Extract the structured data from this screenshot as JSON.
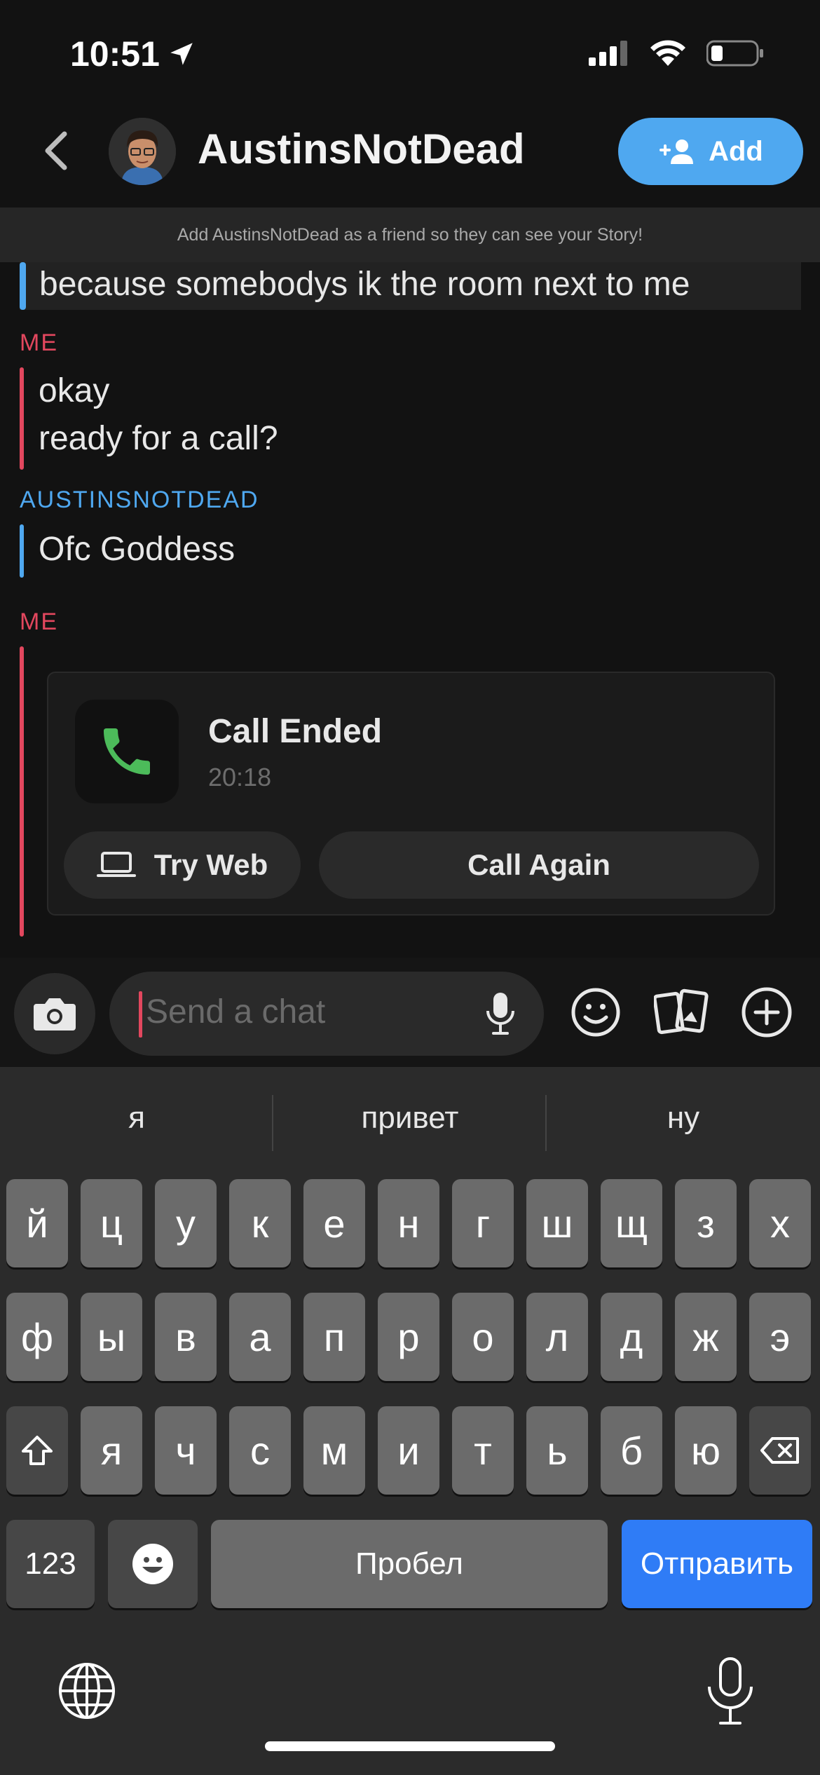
{
  "status_bar": {
    "time": "10:51"
  },
  "header": {
    "friend_name": "AustinsNotDead",
    "add_label": "Add",
    "banner": "Add AustinsNotDead as a friend so they can see your Story!"
  },
  "messages": {
    "previous_text": "because somebodys ik the room next to me",
    "me_label": "ME",
    "them_label": "AUSTINSNOTDEAD",
    "me_msg_1": "okay",
    "me_msg_2": "ready for a call?",
    "them_msg": "Ofc Goddess",
    "me_label_2": "ME"
  },
  "call_card": {
    "title": "Call Ended",
    "time": "20:18",
    "try_web": "Try Web",
    "call_again": "Call Again"
  },
  "input": {
    "placeholder": "Send a chat"
  },
  "keyboard": {
    "suggestions": [
      "я",
      "привет",
      "ну"
    ],
    "row1": [
      "й",
      "ц",
      "у",
      "к",
      "е",
      "н",
      "г",
      "ш",
      "щ",
      "з",
      "х"
    ],
    "row2": [
      "ф",
      "ы",
      "в",
      "а",
      "п",
      "р",
      "о",
      "л",
      "д",
      "ж",
      "э"
    ],
    "row3": [
      "я",
      "ч",
      "с",
      "м",
      "и",
      "т",
      "ь",
      "б",
      "ю"
    ],
    "numbers_key": "123",
    "space_key": "Пробел",
    "send_key": "Отправить"
  },
  "colors": {
    "me": "#e2475e",
    "them": "#4fa8f0",
    "add_button": "#4fa8f0",
    "send_key": "#2f7cf6",
    "call_icon": "#4cbb5a"
  }
}
